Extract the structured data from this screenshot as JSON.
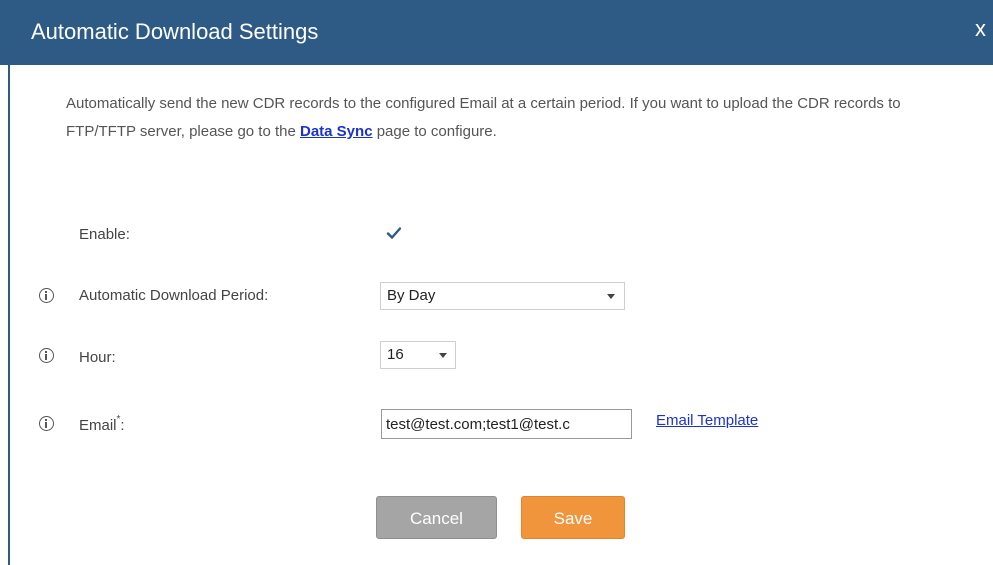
{
  "dialog": {
    "title": "Automatic Download Settings",
    "close_label": "x"
  },
  "description": {
    "text_before": "Automatically send the new CDR records to the configured Email at a certain period. If you want to upload the CDR records to FTP/TFTP server, please go to the ",
    "link_label": "Data Sync",
    "text_after": " page to configure."
  },
  "form": {
    "enable": {
      "label": "Enable:",
      "checked": true
    },
    "period": {
      "label": "Automatic Download Period:",
      "value": "By Day"
    },
    "hour": {
      "label": "Hour:",
      "value": "16"
    },
    "email": {
      "label": "Email",
      "required_mark": "*",
      "label_suffix": ":",
      "value": "test@test.com;test1@test.c",
      "template_link": "Email Template"
    }
  },
  "buttons": {
    "cancel_label": "Cancel",
    "save_label": "Save"
  },
  "colors": {
    "title_bar": "#2e5b86",
    "link": "#1a33cc",
    "save_button": "#f0953c",
    "cancel_button": "#a5a5a5"
  },
  "icons": {
    "info": "info-circle-icon",
    "check": "checkmark-icon",
    "dropdown": "chevron-down-icon",
    "close": "close-icon"
  }
}
